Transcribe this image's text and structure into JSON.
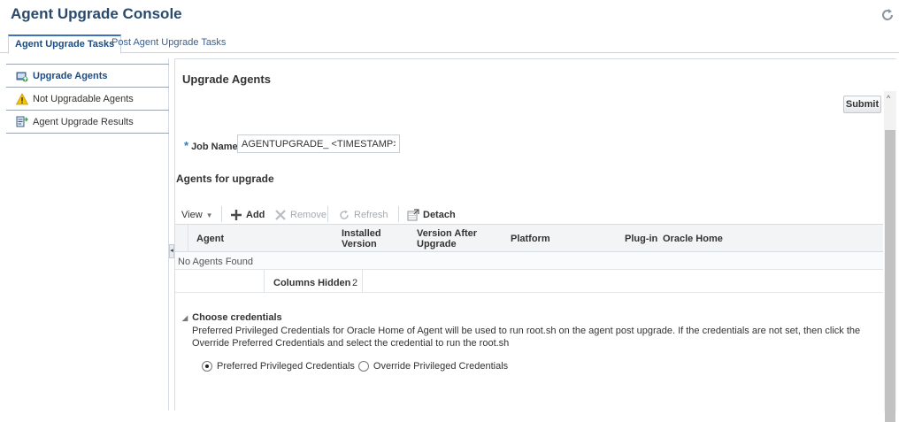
{
  "header": {
    "title": "Agent Upgrade Console"
  },
  "tabs": [
    {
      "label": "Agent Upgrade Tasks",
      "active": true
    },
    {
      "label": "Post Agent Upgrade Tasks",
      "active": false
    }
  ],
  "sidebar": {
    "items": [
      {
        "label": "Upgrade Agents",
        "icon": "upgrade-agents-icon",
        "selected": true
      },
      {
        "label": "Not Upgradable Agents",
        "icon": "warning-icon",
        "selected": false
      },
      {
        "label": "Agent Upgrade Results",
        "icon": "results-icon",
        "selected": false
      }
    ]
  },
  "main": {
    "section_title": "Upgrade Agents",
    "submit_label": "Submit",
    "job_name": {
      "label": "Job Name",
      "required_marker": "*",
      "value": "AGENTUPGRADE_ <TIMESTAMP>"
    },
    "agents_title": "Agents for upgrade",
    "toolbar": {
      "view": "View",
      "add": "Add",
      "remove": "Remove",
      "refresh": "Refresh",
      "detach": "Detach"
    },
    "table": {
      "columns": [
        {
          "line1": "Agent",
          "line2": ""
        },
        {
          "line1": "Installed",
          "line2": "Version"
        },
        {
          "line1": "Version After",
          "line2": "Upgrade"
        },
        {
          "line1": "Platform",
          "line2": ""
        },
        {
          "line1": "Plug-in",
          "line2": ""
        },
        {
          "line1": "Oracle Home",
          "line2": ""
        }
      ],
      "empty_message": "No Agents Found",
      "columns_hidden_label": "Columns Hidden",
      "columns_hidden_value": "2"
    },
    "credentials": {
      "title": "Choose credentials",
      "description": "Preferred Privileged Credentials for Oracle Home of Agent will be used to run root.sh on the agent post upgrade. If the credentials are not set, then click the Override Preferred Credentials and select the credential to run the root.sh",
      "options": [
        {
          "label": "Preferred Privileged Credentials",
          "selected": true
        },
        {
          "label": "Override Privileged Credentials",
          "selected": false
        }
      ]
    }
  },
  "colors": {
    "title": "#2a4a6b",
    "accent": "#3b73b9",
    "link": "#1f4c80",
    "warning": "#f5c300"
  }
}
